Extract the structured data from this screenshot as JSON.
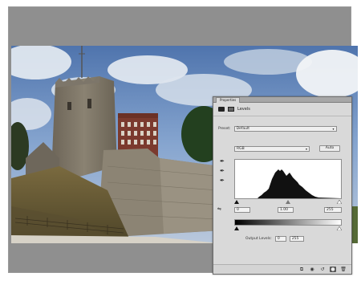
{
  "panel": {
    "tab_title": "Properties",
    "adjustment_name": "Levels",
    "preset_label": "Preset:",
    "preset_value": "Default",
    "channel_value": "RGB",
    "auto_label": "Auto",
    "input_black": "0",
    "input_mid": "1.00",
    "input_white": "255",
    "output_label": "Output Levels:",
    "output_black": "0",
    "output_white": "255"
  },
  "histogram": {
    "description": "luminance histogram",
    "colors": {
      "fill": "#111111",
      "background": "#ffffff"
    }
  },
  "footer_icons": [
    "clip-to-layer-icon",
    "view-previous-icon",
    "reset-icon",
    "visibility-icon",
    "delete-icon"
  ],
  "colors": {
    "frame_gray": "#8f8f8f",
    "panel_bg": "#d9d9d9",
    "panel_titlebar": "#a7a7a7"
  }
}
